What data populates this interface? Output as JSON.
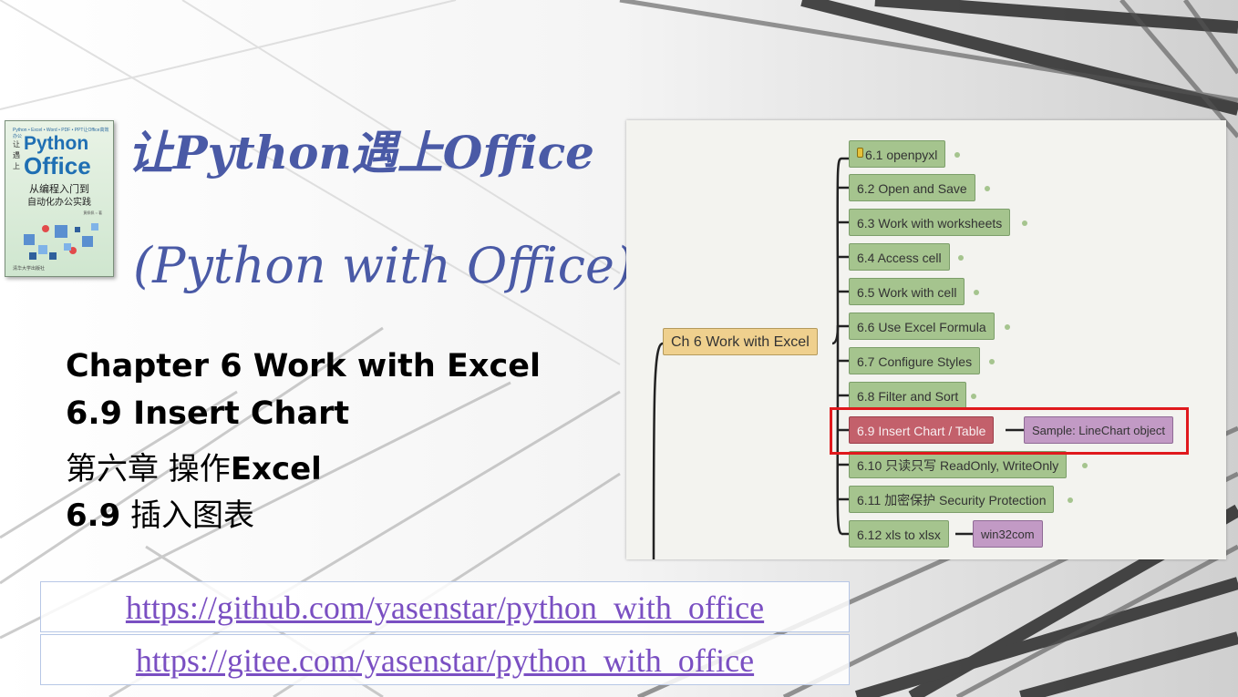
{
  "book": {
    "series": "Python • Excel • Word • PDF • PPT让Office高效办公",
    "side": "让遇上",
    "title_top": "Python",
    "title_bottom": "Office",
    "subtitle_1": "从编程入门到",
    "subtitle_2": "自动化办公实践",
    "author": "黄佩佩 ○ 著",
    "publisher": "清华大学出版社"
  },
  "heading": {
    "title_cn": "让Python遇上Office",
    "title_en": "(Python with Office)"
  },
  "chapter": {
    "line1": "Chapter 6 Work with Excel",
    "line2": "6.9 Insert Chart",
    "line3_cn": "第六章 操作",
    "line3_bold": "Excel",
    "line4_bold": "6.9",
    "line4_cn": " 插入图表"
  },
  "links": [
    "https://github.com/yasenstar/python_with_office",
    "https://gitee.com/yasenstar/python_with_office"
  ],
  "mindmap": {
    "root": "Ch 6 Work with Excel",
    "items": [
      "6.1 openpyxl",
      "6.2 Open and Save",
      "6.3 Work with worksheets",
      "6.4 Access cell",
      "6.5 Work with cell",
      "6.6 Use Excel Formula",
      "6.7 Configure Styles",
      "6.8 Filter and Sort",
      "6.9 Insert Chart / Table",
      "6.10 只读只写 ReadOnly, WriteOnly",
      "6.11 加密保护 Security Protection",
      "6.12 xls to xlsx"
    ],
    "sample_note": "Sample: LineChart object",
    "win32_note": "win32com"
  },
  "colors": {
    "title": "#4a5aa6",
    "link": "#7a4fc2",
    "node_green": "#a5c48e",
    "node_root": "#efd08e",
    "node_selected": "#c3606b",
    "node_note": "#c29ac5",
    "highlight": "#e0191d"
  }
}
